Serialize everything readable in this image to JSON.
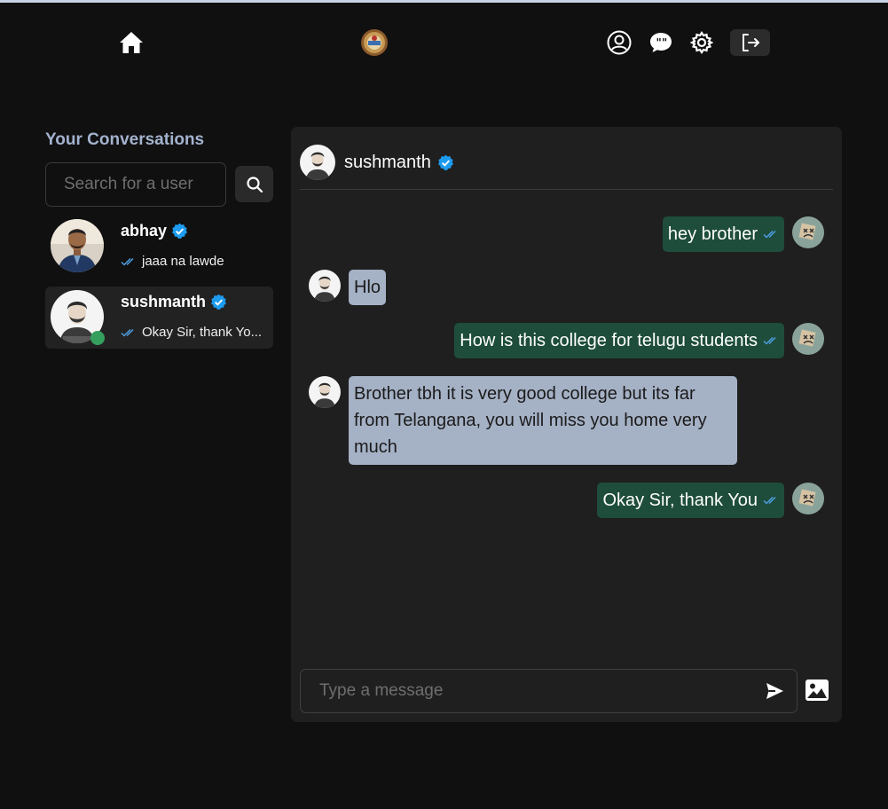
{
  "nav": {
    "home_icon": "home-icon",
    "logo_icon": "college-logo",
    "profile_icon": "user-circle-icon",
    "chat_icon": "chat-bubbles-icon",
    "settings_icon": "gear-icon",
    "logout_icon": "logout-icon"
  },
  "sidebar": {
    "title": "Your Conversations",
    "search_placeholder": "Search for a user",
    "conversations": [
      {
        "name": "abhay",
        "verified": true,
        "last_message": "jaaa na lawde",
        "online": false
      },
      {
        "name": "sushmanth",
        "verified": true,
        "last_message": "Okay Sir, thank Yo...",
        "online": true
      }
    ]
  },
  "chat": {
    "name": "sushmanth",
    "verified": true,
    "messages": [
      {
        "from": "me",
        "text": "hey brother",
        "seen": true
      },
      {
        "from": "them",
        "text": "Hlo"
      },
      {
        "from": "me",
        "text": "How is this college for telugu students",
        "seen": true
      },
      {
        "from": "them",
        "text": "Brother tbh it is very good college but its far from Telangana, you will miss you home very much"
      },
      {
        "from": "me",
        "text": "Okay Sir, thank You",
        "seen": true
      }
    ],
    "input_placeholder": "Type a message"
  },
  "colors": {
    "background": "#101010",
    "panel": "#1f1f1f",
    "outgoing_bubble": "#1e4d3b",
    "incoming_bubble": "#a5b1c5",
    "verified_badge": "#1d9bf0",
    "online_dot": "#35a05e",
    "title": "#a3b3ce"
  }
}
